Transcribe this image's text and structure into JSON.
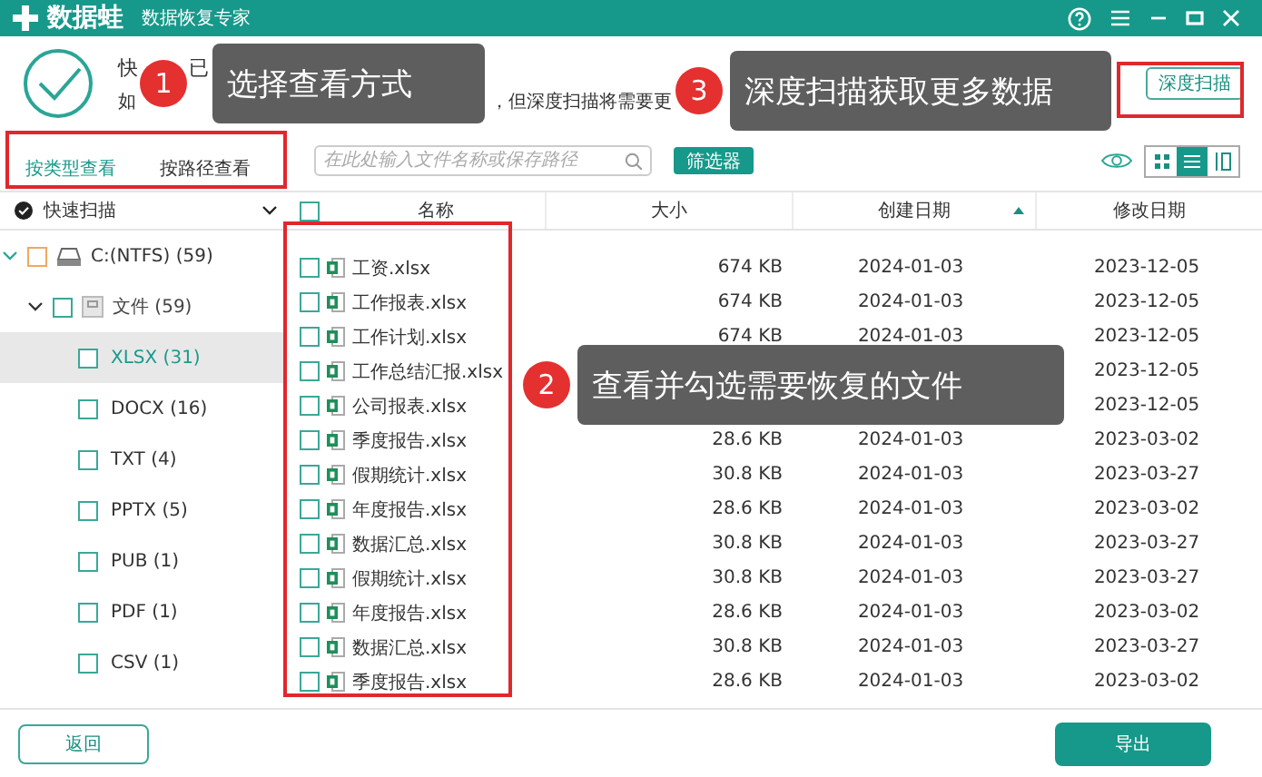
{
  "window": {
    "logo": "数据蛙",
    "subtitle": "数据恢复专家"
  },
  "status": {
    "title_parts": [
      "快",
      "已"
    ],
    "hint_parts": [
      "如",
      "，但深度扫描将需要更"
    ]
  },
  "deep_scan_button": "深度扫描",
  "view_tabs": [
    {
      "label": "按类型查看",
      "selected": true
    },
    {
      "label": "按路径查看",
      "selected": false
    }
  ],
  "search": {
    "placeholder": "在此处输入文件名称或保存路径"
  },
  "filter_button": "筛选器",
  "view_modes": [
    {
      "kind": "grid",
      "selected": false
    },
    {
      "kind": "list",
      "selected": true
    },
    {
      "kind": "columns",
      "selected": false
    }
  ],
  "scan_mode": {
    "label": "快速扫描"
  },
  "tree": [
    {
      "label": "C:(NTFS) (59)",
      "kind": "drive",
      "expanded": true,
      "selected": false,
      "checked": false,
      "children": [
        {
          "label": "文件 (59)",
          "kind": "folder",
          "expanded": true,
          "selected": false,
          "checked": false,
          "children": [
            {
              "label": "XLSX (31)",
              "kind": "type",
              "selected": true,
              "checked": false
            },
            {
              "label": "DOCX (16)",
              "kind": "type",
              "selected": false,
              "checked": false
            },
            {
              "label": "TXT (4)",
              "kind": "type",
              "selected": false,
              "checked": false
            },
            {
              "label": "PPTX (5)",
              "kind": "type",
              "selected": false,
              "checked": false
            },
            {
              "label": "PUB (1)",
              "kind": "type",
              "selected": false,
              "checked": false
            },
            {
              "label": "PDF (1)",
              "kind": "type",
              "selected": false,
              "checked": false
            },
            {
              "label": "CSV (1)",
              "kind": "type",
              "selected": false,
              "checked": false
            }
          ]
        }
      ]
    }
  ],
  "table": {
    "all_checked": false,
    "columns": [
      {
        "label": "名称"
      },
      {
        "label": "大小"
      },
      {
        "label": "创建日期",
        "sort_ascending": true
      },
      {
        "label": "修改日期"
      }
    ],
    "rows": [
      {
        "name": "工资.xlsx",
        "size": "674 KB",
        "created": "2024-01-03",
        "modified": "2023-12-05",
        "checked": false
      },
      {
        "name": "工作报表.xlsx",
        "size": "674 KB",
        "created": "2024-01-03",
        "modified": "2023-12-05",
        "checked": false
      },
      {
        "name": "工作计划.xlsx",
        "size": "674 KB",
        "created": "2024-01-03",
        "modified": "2023-12-05",
        "checked": false
      },
      {
        "name": "工作总结汇报.xlsx",
        "modified": "2023-12-05",
        "checked": false
      },
      {
        "name": "公司报表.xlsx",
        "modified": "2023-12-05",
        "checked": false
      },
      {
        "name": "季度报告.xlsx",
        "size": "28.6 KB",
        "created": "2024-01-03",
        "modified": "2023-03-02",
        "checked": false
      },
      {
        "name": "假期统计.xlsx",
        "size": "30.8 KB",
        "created": "2024-01-03",
        "modified": "2023-03-27",
        "checked": false
      },
      {
        "name": "年度报告.xlsx",
        "size": "28.6 KB",
        "created": "2024-01-03",
        "modified": "2023-03-02",
        "checked": false
      },
      {
        "name": "数据汇总.xlsx",
        "size": "30.8 KB",
        "created": "2024-01-03",
        "modified": "2023-03-27",
        "checked": false
      },
      {
        "name": "假期统计.xlsx",
        "size": "30.8 KB",
        "created": "2024-01-03",
        "modified": "2023-03-27",
        "checked": false
      },
      {
        "name": "年度报告.xlsx",
        "size": "28.6 KB",
        "created": "2024-01-03",
        "modified": "2023-03-02",
        "checked": false
      },
      {
        "name": "数据汇总.xlsx",
        "size": "30.8 KB",
        "created": "2024-01-03",
        "modified": "2023-03-27",
        "checked": false
      },
      {
        "name": "季度报告.xlsx",
        "size": "28.6 KB",
        "created": "2024-01-03",
        "modified": "2023-03-02",
        "checked": false
      }
    ]
  },
  "buttons": {
    "back": "返回",
    "export": "导出"
  },
  "callouts": [
    {
      "number": "1",
      "text": "选择查看方式"
    },
    {
      "number": "3",
      "text": "深度扫描获取更多数据"
    },
    {
      "number": "2",
      "text": "查看并勾选需要恢复的文件"
    }
  ]
}
